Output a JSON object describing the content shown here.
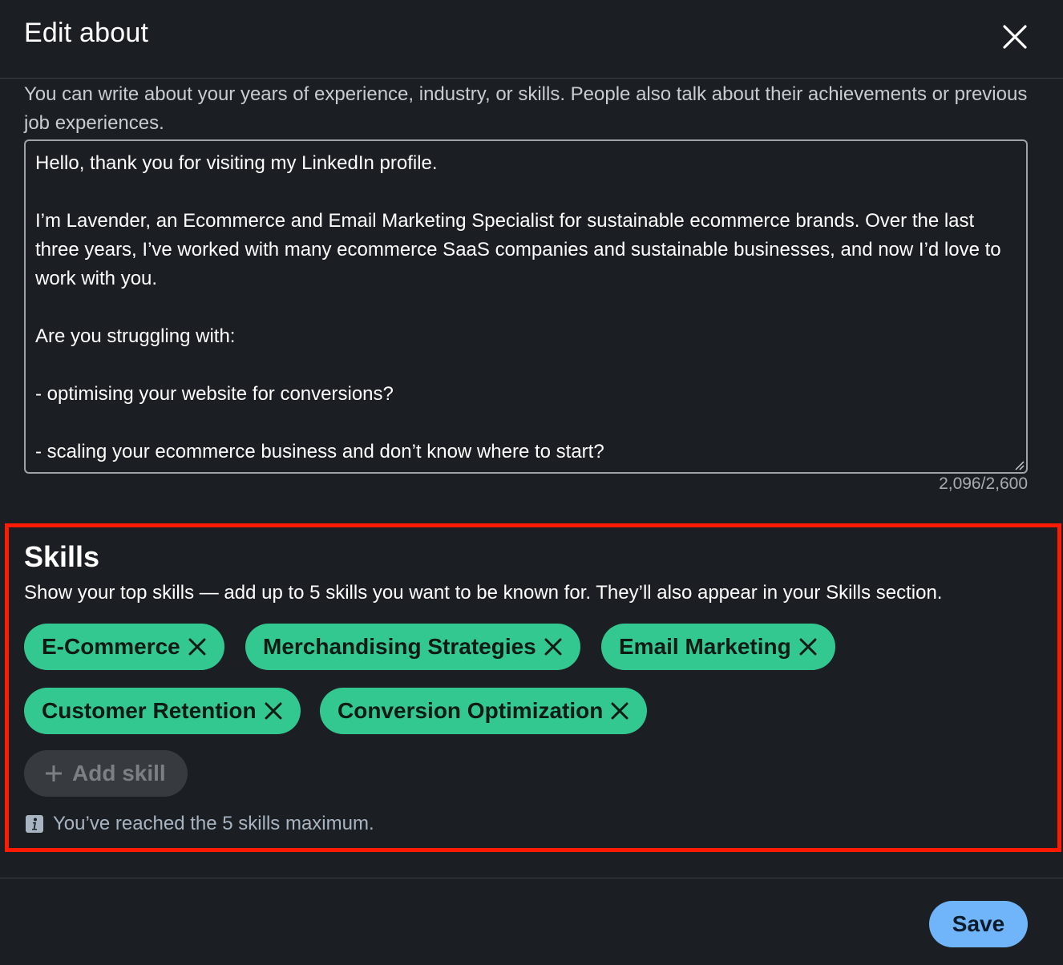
{
  "dialog": {
    "title": "Edit about",
    "close_icon": "close-icon"
  },
  "about": {
    "intro": "You can write about your years of experience, industry, or skills. People also talk about their achievements or previous job experiences.",
    "text": "Hello, thank you for visiting my LinkedIn profile.\n\nI’m Lavender, an Ecommerce and Email Marketing Specialist for sustainable ecommerce brands. Over the last three years, I’ve worked with many ecommerce SaaS companies and sustainable businesses, and now I’d love to work with you.\n\nAre you struggling with:\n\n- optimising your website for conversions?\n\n- scaling your ecommerce business and don’t know where to start?",
    "char_count": "2,096/2,600"
  },
  "skills": {
    "title": "Skills",
    "description": "Show your top skills — add up to 5 skills you want to be known for. They’ll also appear in your Skills section.",
    "items": [
      {
        "label": "E-Commerce"
      },
      {
        "label": "Merchandising Strategies"
      },
      {
        "label": "Email Marketing"
      },
      {
        "label": "Customer Retention"
      },
      {
        "label": "Conversion Optimization"
      }
    ],
    "add_label": "Add skill",
    "limit_note": "You’ve reached the 5 skills maximum.",
    "pill_color": "#34c891",
    "highlight_color": "#ff1a00"
  },
  "footer": {
    "save_label": "Save",
    "save_color": "#70b5f9"
  }
}
